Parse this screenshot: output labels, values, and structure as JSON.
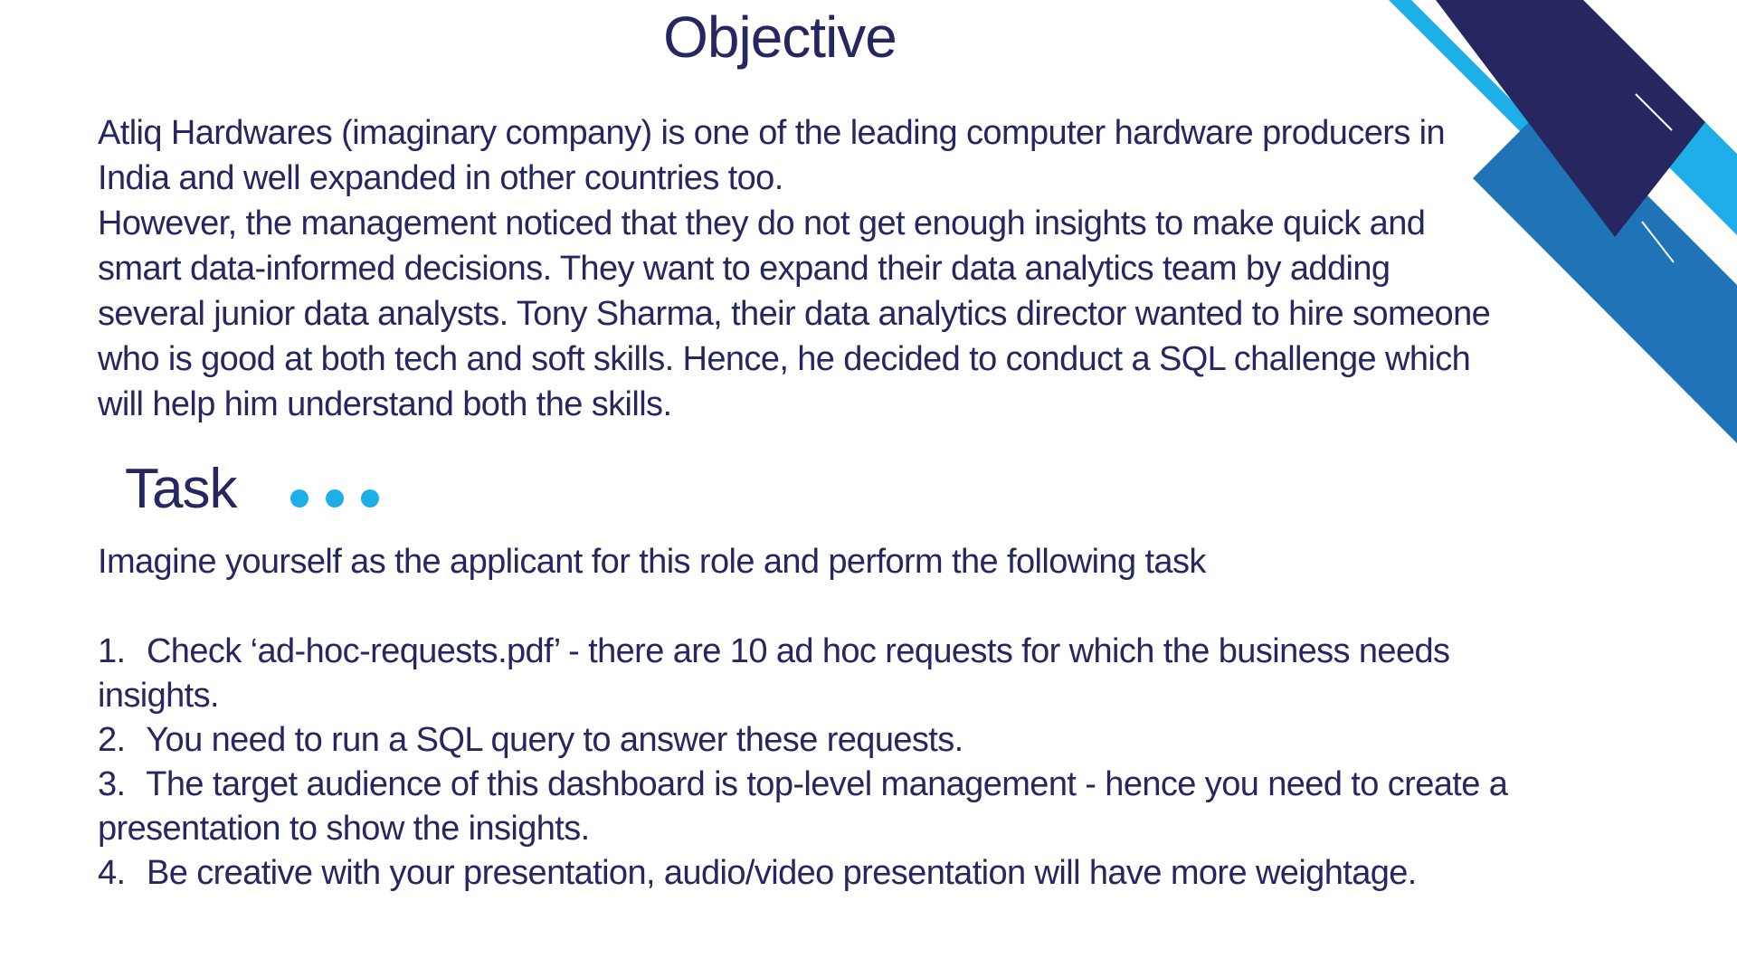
{
  "slide": {
    "title": "Objective",
    "objective_paragraphs": [
      "Atliq Hardwares (imaginary company) is one of the leading computer hardware producers in India and well expanded in other countries too.",
      "However, the management noticed that they do not get enough insights to make quick and smart data-informed decisions. They want to expand their data analytics team by adding several junior data analysts. Tony Sharma, their data analytics director wanted to hire someone who is good at both tech and soft skills. Hence, he decided to conduct a SQL challenge which will help him understand both the skills."
    ],
    "task_heading": "Task",
    "task_intro": "Imagine yourself as the applicant for this role and perform the following task",
    "task_items": [
      {
        "number": "1.",
        "text": "Check ‘ad-hoc-requests.pdf’ - there are 10 ad hoc requests for which the business needs insights."
      },
      {
        "number": "2.",
        "text": "You need to run a SQL query to answer these requests."
      },
      {
        "number": "3.",
        "text": "The target audience of this dashboard is top-level management - hence you need to create a presentation to show the insights."
      },
      {
        "number": "4.",
        "text": "Be creative with your presentation, audio/video presentation will have more weightage."
      }
    ]
  },
  "colors": {
    "text_navy": "#262660",
    "accent_cyan": "#1eaee8",
    "accent_blue": "#1f74b8",
    "accent_navy": "#262660",
    "dots": "#1eaee8"
  }
}
